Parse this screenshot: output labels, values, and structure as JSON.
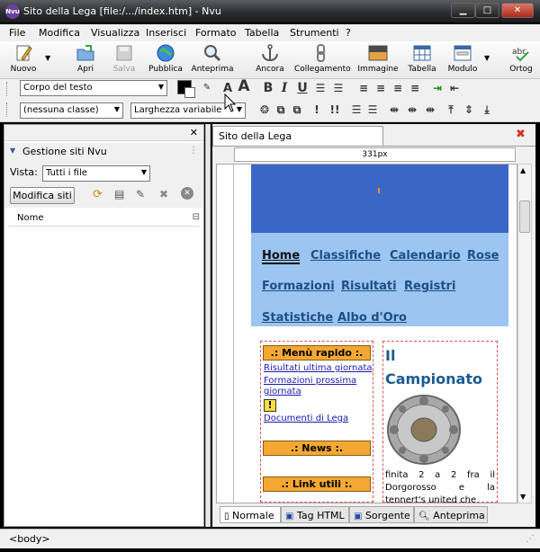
{
  "window": {
    "title": "Sito della Lega [file:/.../index.htm] - Nvu",
    "app_icon_text": "Nvu",
    "min": "▁",
    "max": "□",
    "close": "✕"
  },
  "menu": [
    "File",
    "Modifica",
    "Visualizza",
    "Inserisci",
    "Formato",
    "Tabella",
    "Strumenti",
    "?"
  ],
  "toolbar": {
    "new": "Nuovo",
    "open": "Apri",
    "save": "Salva",
    "publish": "Pubblica",
    "preview": "Anteprima",
    "anchor": "Ancora",
    "link": "Collegamento",
    "image": "Immagine",
    "table": "Tabella",
    "form": "Modulo",
    "spell": "Ortog"
  },
  "format": {
    "paragraph_style": "Corpo del testo",
    "class_select": "(nessuna classe)",
    "width_select": "Larghezza variabile",
    "bold": "B",
    "italic": "I",
    "underline": "U",
    "font_smaller": "A",
    "font_larger": "A"
  },
  "site_panel": {
    "title": "Gestione siti Nvu",
    "view_label": "Vista:",
    "view_value": "Tutti i file",
    "edit_sites": "Modifica siti",
    "column_name": "Nome"
  },
  "editor": {
    "tab_title": "Sito della Lega",
    "ruler_label": "331px",
    "modes": [
      "Normale",
      "Tag HTML",
      "Sorgente",
      "Anteprima"
    ]
  },
  "page": {
    "nav": {
      "row1": [
        "Home",
        "Classifiche",
        "Calendario",
        "Rose"
      ],
      "row2": [
        "Formazioni",
        "Risultati",
        "Registri"
      ],
      "row3": [
        "Statistiche",
        "Albo d'Oro"
      ]
    },
    "quick_menu_title": ".: Menù rapido :.",
    "quick_links": [
      "Risultati ultima giornata",
      "Formazioni prossima",
      "giornata"
    ],
    "warning_icon": "!",
    "documents_link": "Documenti di Lega",
    "news_title": ".: News :.",
    "links_title": ".: Link utili :.",
    "heading_line1": "Il",
    "heading_line2": "Campionato",
    "body_text": "finita 2 a 2 fra il Dorgorosso e la tennert's united che"
  },
  "status": {
    "tag": "<body>"
  }
}
